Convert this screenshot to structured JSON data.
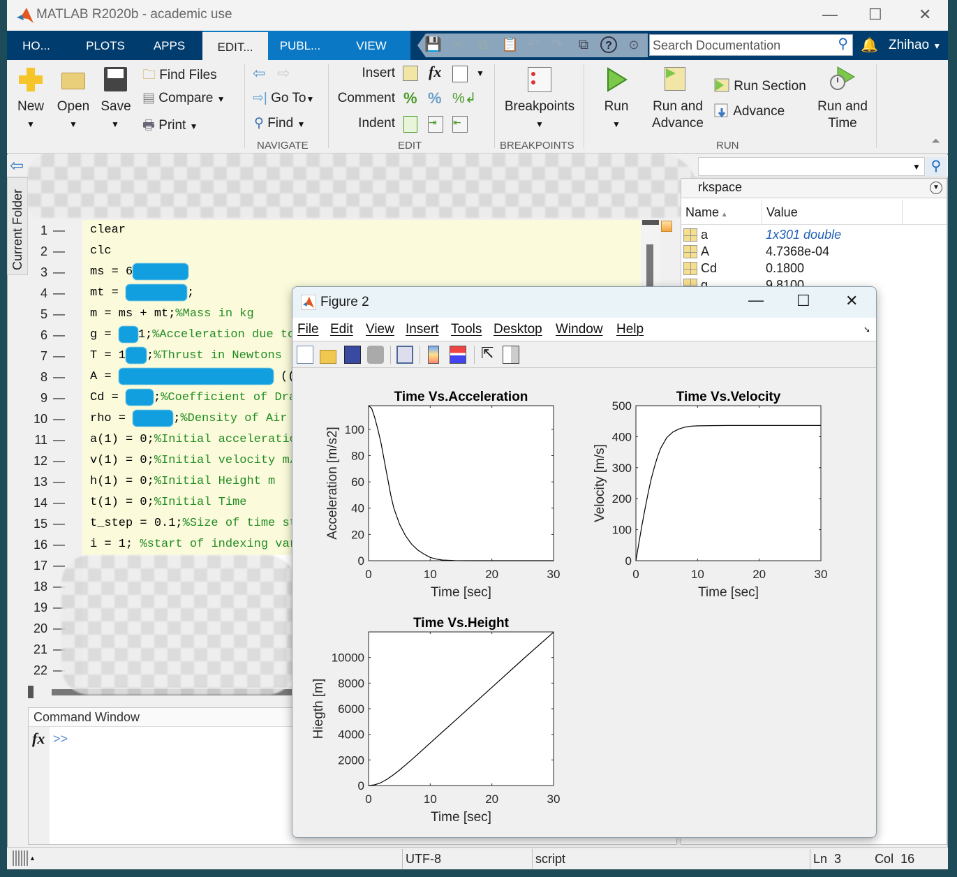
{
  "window": {
    "title": "MATLAB R2020b - academic use",
    "minimize": "—",
    "maximize": "☐",
    "close": "✕"
  },
  "tabs": [
    {
      "label": "HO..."
    },
    {
      "label": "PLOTS"
    },
    {
      "label": "APPS"
    },
    {
      "label": "EDIT...",
      "active": true
    },
    {
      "label": "PUBL..."
    },
    {
      "label": "VIEW"
    }
  ],
  "search": {
    "placeholder": "Search Documentation"
  },
  "user": {
    "name": "Zhihao"
  },
  "toolstrip": {
    "new": "New",
    "open": "Open",
    "save": "Save",
    "find_files": "Find Files",
    "compare": "Compare",
    "print": "Print",
    "go_to": "Go To",
    "find": "Find",
    "insert": "Insert",
    "comment": "Comment",
    "indent": "Indent",
    "breakpoints": "Breakpoints",
    "run": "Run",
    "run_and_advance": "Run and\nAdvance",
    "run_section": "Run Section",
    "advance": "Advance",
    "run_and_time": "Run and\nTime",
    "sections": {
      "navigate": "NAVIGATE",
      "edit": "EDIT",
      "breakpoints": "BREAKPOINTS",
      "run": "RUN"
    }
  },
  "side_tab": {
    "label": "Current Folder"
  },
  "editor": {
    "lines": [
      {
        "n": "1",
        "parts": [
          {
            "t": "clear"
          }
        ]
      },
      {
        "n": "2",
        "parts": [
          {
            "t": "clc"
          }
        ]
      },
      {
        "n": "3",
        "parts": [
          {
            "t": "ms = 6"
          },
          {
            "redacted": true,
            "w": 80
          }
        ]
      },
      {
        "n": "4",
        "parts": [
          {
            "t": "mt = "
          },
          {
            "redacted": true,
            "w": 88
          },
          {
            "t": ";"
          }
        ]
      },
      {
        "n": "5",
        "parts": [
          {
            "t": "m = ms + mt;"
          },
          {
            "t": "%Mass in kg",
            "comment": true
          }
        ]
      },
      {
        "n": "6",
        "parts": [
          {
            "t": "g = "
          },
          {
            "redacted": true,
            "w": 28
          },
          {
            "t": "1;"
          },
          {
            "t": "%Acceleration due to",
            "comment": true
          }
        ]
      },
      {
        "n": "7",
        "parts": [
          {
            "t": "T = 1"
          },
          {
            "redacted": true,
            "w": 30
          },
          {
            "t": ";"
          },
          {
            "t": "%Thrust in Newtons",
            "comment": true
          }
        ]
      },
      {
        "n": "8",
        "parts": [
          {
            "t": "A = "
          },
          {
            "redacted": true,
            "w": 222
          },
          {
            "t": " (("
          }
        ]
      },
      {
        "n": "9",
        "parts": [
          {
            "t": "Cd = "
          },
          {
            "redacted": true,
            "w": 40
          },
          {
            "t": ";"
          },
          {
            "t": "%Coefficient of Dra",
            "comment": true
          }
        ]
      },
      {
        "n": "10",
        "parts": [
          {
            "t": "rho = "
          },
          {
            "redacted": true,
            "w": 58
          },
          {
            "t": ";"
          },
          {
            "t": "%Density of Air k",
            "comment": true
          }
        ]
      },
      {
        "n": "11",
        "parts": [
          {
            "t": "a(1) = 0;"
          },
          {
            "t": "%Initial acceleratio",
            "comment": true
          }
        ]
      },
      {
        "n": "12",
        "parts": [
          {
            "t": "v(1) = 0;"
          },
          {
            "t": "%Initial velocity m/",
            "comment": true
          }
        ]
      },
      {
        "n": "13",
        "parts": [
          {
            "t": "h(1) = 0;"
          },
          {
            "t": "%Initial Height m",
            "comment": true
          }
        ]
      },
      {
        "n": "14",
        "parts": [
          {
            "t": "t(1) = 0;"
          },
          {
            "t": "%Initial Time",
            "comment": true
          }
        ]
      },
      {
        "n": "15",
        "parts": [
          {
            "t": "t_step = 0.1;"
          },
          {
            "t": "%Size of time st",
            "comment": true
          }
        ]
      },
      {
        "n": "16",
        "parts": [
          {
            "t": "i = 1; "
          },
          {
            "t": "%start of indexing var",
            "comment": true
          }
        ]
      },
      {
        "n": "17",
        "parts": []
      },
      {
        "n": "18",
        "parts": []
      },
      {
        "n": "19",
        "parts": []
      },
      {
        "n": "20",
        "parts": []
      },
      {
        "n": "21",
        "parts": []
      },
      {
        "n": "22",
        "parts": []
      }
    ]
  },
  "command_window": {
    "title": "Command Window",
    "fx": "fx",
    "prompt": ">>"
  },
  "workspace": {
    "title": "rkspace",
    "columns": {
      "name": "Name",
      "value": "Value"
    },
    "rows": [
      {
        "name": "a",
        "value": "1x301 double",
        "link": true
      },
      {
        "name": "A",
        "value": "4.7368e-04"
      },
      {
        "name": "Cd",
        "value": "0.1800"
      },
      {
        "name": "g",
        "value": "9.8100"
      }
    ]
  },
  "status": {
    "encoding": "UTF-8",
    "type": "script",
    "ln_label": "Ln",
    "ln": "3",
    "col_label": "Col",
    "col": "16"
  },
  "figure": {
    "title": "Figure 2",
    "menu": [
      "File",
      "Edit",
      "View",
      "Insert",
      "Tools",
      "Desktop",
      "Window",
      "Help"
    ],
    "toolbar_icons": [
      "new-figure-icon",
      "open-file-icon",
      "save-icon",
      "print-icon",
      "link-plot-icon",
      "colorbar-icon",
      "legend-icon",
      "pointer-icon",
      "property-inspector-icon"
    ]
  },
  "chart_data": [
    {
      "type": "line",
      "title": "Time Vs.Acceleration",
      "xlabel": "Time [sec]",
      "ylabel": "Acceleration [m/s2]",
      "xlim": [
        0,
        30
      ],
      "ylim": [
        0,
        118
      ],
      "xticks": [
        0,
        10,
        20,
        30
      ],
      "yticks": [
        0,
        20,
        40,
        60,
        80,
        100
      ],
      "grid": false,
      "x": [
        0,
        0.5,
        1,
        1.5,
        2,
        2.4,
        2.8,
        3.2,
        3.6,
        4.1,
        5,
        6,
        7,
        8,
        9,
        10,
        11,
        12,
        14,
        16,
        20,
        25,
        30
      ],
      "y": [
        118,
        116,
        109,
        100,
        90,
        80,
        70,
        60,
        50,
        40,
        28,
        19,
        12.5,
        8,
        5,
        2.5,
        1.2,
        0.5,
        0.1,
        0,
        0,
        0,
        0
      ]
    },
    {
      "type": "line",
      "title": "Time Vs.Velocity",
      "xlabel": "Time [sec]",
      "ylabel": "Velocity [m/s]",
      "xlim": [
        0,
        30
      ],
      "ylim": [
        0,
        500
      ],
      "xticks": [
        0,
        10,
        20,
        30
      ],
      "yticks": [
        0,
        100,
        200,
        300,
        400,
        500
      ],
      "grid": false,
      "x": [
        0,
        0.5,
        1,
        1.5,
        2,
        2.5,
        3,
        3.5,
        4,
        5,
        6,
        7,
        8,
        9,
        10,
        12,
        15,
        20,
        25,
        30
      ],
      "y": [
        0,
        59,
        116,
        170,
        220,
        265,
        302,
        335,
        362,
        397,
        415,
        425,
        431,
        434,
        435,
        435.5,
        436,
        436,
        436,
        436
      ]
    },
    {
      "type": "line",
      "title": "Time Vs.Height",
      "xlabel": "Time [sec]",
      "ylabel": "Hiegth [m]",
      "xlim": [
        0,
        30
      ],
      "ylim": [
        0,
        12000
      ],
      "xticks": [
        0,
        10,
        20,
        30
      ],
      "yticks": [
        0,
        2000,
        4000,
        6000,
        8000,
        10000
      ],
      "grid": false,
      "x": [
        0,
        1,
        2,
        3,
        4,
        5,
        6,
        7,
        8,
        9,
        10,
        15,
        20,
        25,
        30
      ],
      "y": [
        0,
        57,
        225,
        490,
        825,
        1200,
        1605,
        2025,
        2450,
        2885,
        3320,
        5495,
        7670,
        9845,
        11980
      ]
    }
  ]
}
